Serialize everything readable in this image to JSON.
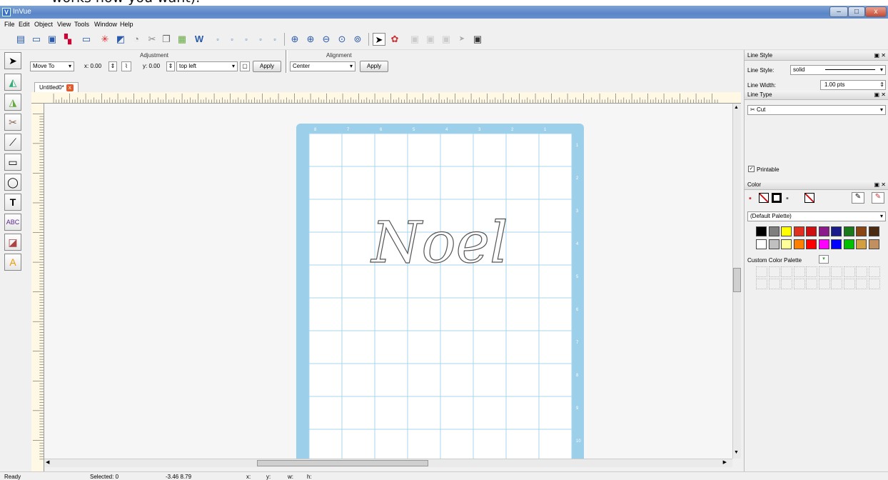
{
  "top_text": "works how you want).",
  "app": {
    "title": "InVue",
    "logo": "V"
  },
  "window_buttons": {
    "minimize": "–",
    "maximize": "□",
    "close": "x"
  },
  "menu": [
    "File",
    "Edit",
    "Object",
    "View",
    "Tools",
    "Window",
    "Help"
  ],
  "toolbar_icons": [
    "text-import-icon",
    "save-icon",
    "save-as-icon",
    "grid-icon",
    "ruler-icon",
    "laser-icon",
    "eraser-icon",
    "trace-icon",
    "scissors-icon",
    "copy-icon",
    "paste-icon",
    "word-icon",
    "align-1-icon",
    "align-2-icon",
    "align-3-icon",
    "align-4-icon",
    "zoom-in-icon",
    "zoom-in-2-icon",
    "zoom-out-icon",
    "zoom-fit-icon",
    "zoom-actual-icon",
    "select-arrow-icon",
    "color-wheel-icon",
    "group-icon",
    "ungroup-icon",
    "combine-icon",
    "node-arrow-icon",
    "frame-icon"
  ],
  "adjustment": {
    "title": "Adjustment",
    "mode": "Move To",
    "x": "x: 0.00",
    "y": "y: 0.00",
    "anchor": "top left",
    "apply": "Apply"
  },
  "alignment": {
    "title": "Alignment",
    "mode": "Center",
    "apply": "Apply"
  },
  "document_tab": "Untitled0*",
  "canvas_text": "Noel",
  "mat_top_labels": [
    "8",
    "7",
    "6",
    "5",
    "4",
    "3",
    "2",
    "1"
  ],
  "mat_side_labels": [
    "1",
    "2",
    "3",
    "4",
    "5",
    "6",
    "7",
    "8",
    "9",
    "10"
  ],
  "panels": {
    "line_style": {
      "title": "Line Style",
      "style_label": "Line Style:",
      "style_value": "solid",
      "width_label": "Line Width:",
      "width_value": "1.00 pts"
    },
    "line_type": {
      "title": "Line Type",
      "value": "Cut",
      "printable": "Printable"
    },
    "color": {
      "title": "Color",
      "palette": "(Default Palette)",
      "custom": "Custom Color Palette"
    }
  },
  "palette_row1": [
    "#000000",
    "#7f7f7f",
    "#ffff00",
    "#e03020",
    "#d01010",
    "#8b1a8b",
    "#1a1a8b",
    "#1a7a1a",
    "#8b4513",
    "#4a2a10"
  ],
  "palette_row2": [
    "#ffffff",
    "#c0c0c0",
    "#ffff99",
    "#ff8000",
    "#ff0000",
    "#ff00ff",
    "#0000ff",
    "#00c000",
    "#d2a040",
    "#c09060"
  ],
  "status": {
    "ready": "Ready",
    "selected": "Selected: 0",
    "coords": "-3.46  8.79",
    "x": "x:",
    "y": "y:",
    "w": "w:",
    "h:": "h:"
  }
}
